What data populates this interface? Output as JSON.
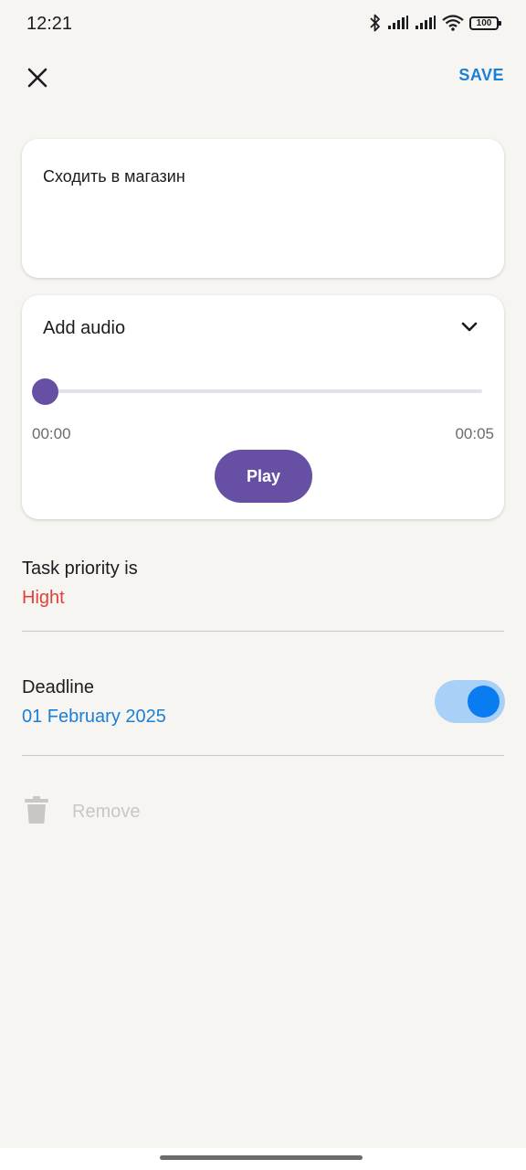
{
  "status_bar": {
    "time": "12:21",
    "battery": "100",
    "icons": [
      "bluetooth-icon",
      "signal-icon",
      "signal-icon",
      "wifi-icon",
      "battery-icon"
    ]
  },
  "toolbar": {
    "close_icon": "close-icon",
    "save_label": "SAVE"
  },
  "note": {
    "text": "Сходить в магазин"
  },
  "audio": {
    "title": "Add audio",
    "expand_icon": "chevron-down-icon",
    "progress": 0,
    "current_time": "00:00",
    "total_time": "00:05",
    "play_label": "Play"
  },
  "priority": {
    "label": "Task priority is",
    "value": "Hight"
  },
  "deadline": {
    "label": "Deadline",
    "value": "01 February 2025",
    "enabled": true
  },
  "remove": {
    "icon": "trash-icon",
    "label": "Remove"
  },
  "colors": {
    "accent": "#1a7fd6",
    "play_button": "#6750a4",
    "priority_high": "#e0403a",
    "toggle_on": "#0a7cf2",
    "disabled": "#c9c7c4"
  }
}
